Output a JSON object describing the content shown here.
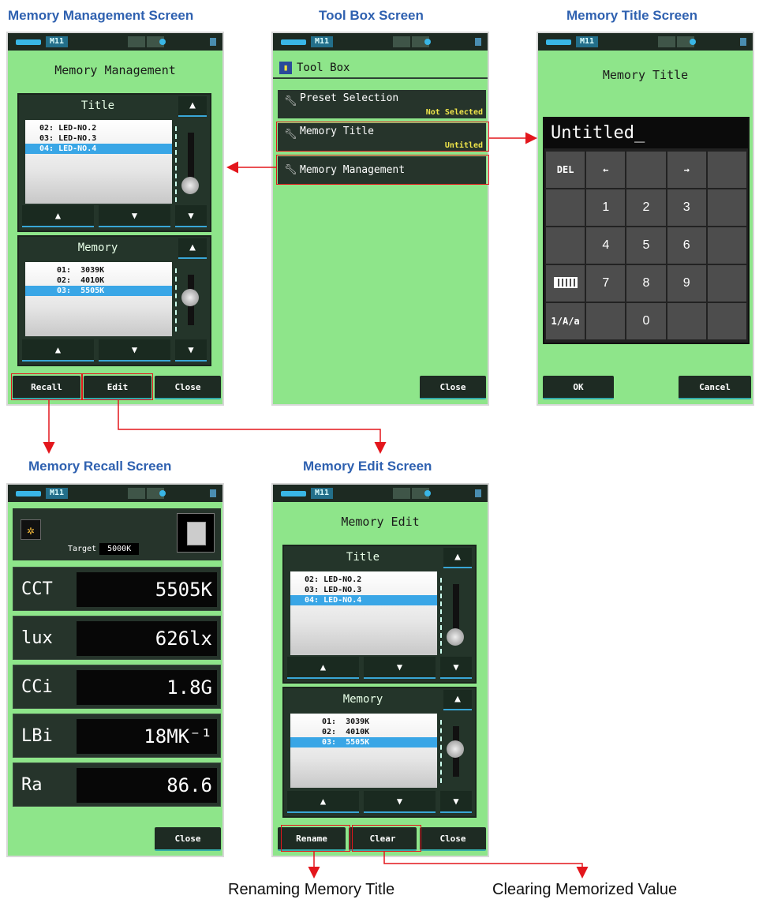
{
  "headings": {
    "memory_management": "Memory Management Screen",
    "tool_box": "Tool Box Screen",
    "memory_title": "Memory Title Screen",
    "memory_recall": "Memory Recall Screen",
    "memory_edit": "Memory Edit Screen"
  },
  "status_bar": {
    "memory": "M11"
  },
  "memory_management": {
    "title": "Memory Management",
    "title_panel": {
      "label": "Title",
      "rows": [
        "02: LED-NO.2",
        "03: LED-NO.3",
        "04: LED-NO.4"
      ],
      "selected": 2
    },
    "memory_panel": {
      "label": "Memory",
      "rows": [
        "01:  3039K",
        "02:  4010K",
        "03:  5505K"
      ],
      "selected": 2
    },
    "buttons": {
      "recall": "Recall",
      "edit": "Edit",
      "close": "Close"
    }
  },
  "tool_box": {
    "title": "Tool Box",
    "items": [
      {
        "label": "Preset Selection",
        "sub": "Not Selected"
      },
      {
        "label": "Memory Title",
        "sub": "Untitled"
      },
      {
        "label": "Memory Management",
        "sub": ""
      }
    ],
    "close": "Close"
  },
  "memory_title": {
    "title": "Memory Title",
    "input": "Untitled_",
    "keys": [
      "DEL",
      "←",
      "",
      "→",
      "",
      "",
      "1",
      "2",
      "3",
      "",
      "",
      "4",
      "5",
      "6",
      "",
      "",
      "7",
      "8",
      "9",
      "",
      "1/A/a",
      "",
      "0",
      "",
      ""
    ],
    "ok": "OK",
    "cancel": "Cancel"
  },
  "memory_recall": {
    "target_label": "Target",
    "target_value": "5000K",
    "measurements": [
      {
        "label": "CCT",
        "value": "5505K"
      },
      {
        "label": "lux",
        "value": "626lx"
      },
      {
        "label": "CCi",
        "value": "1.8G"
      },
      {
        "label": "LBi",
        "value": "18MK⁻¹"
      },
      {
        "label": "Ra",
        "value": "86.6"
      }
    ],
    "close": "Close"
  },
  "memory_edit": {
    "title": "Memory Edit",
    "title_panel": {
      "label": "Title",
      "rows": [
        "02: LED-NO.2",
        "03: LED-NO.3",
        "04: LED-NO.4"
      ],
      "selected": 2
    },
    "memory_panel": {
      "label": "Memory",
      "rows": [
        "01:  3039K",
        "02:  4010K",
        "03:  5505K"
      ],
      "selected": 2
    },
    "buttons": {
      "rename": "Rename",
      "clear": "Clear",
      "close": "Close"
    }
  },
  "captions": {
    "rename": "Renaming Memory Title",
    "clear": "Clearing Memorized Value"
  },
  "colors": {
    "screen_bg": "#8ee58a",
    "heading": "#2f61b0",
    "highlight": "#e3161c",
    "selection": "#39a6e6"
  }
}
